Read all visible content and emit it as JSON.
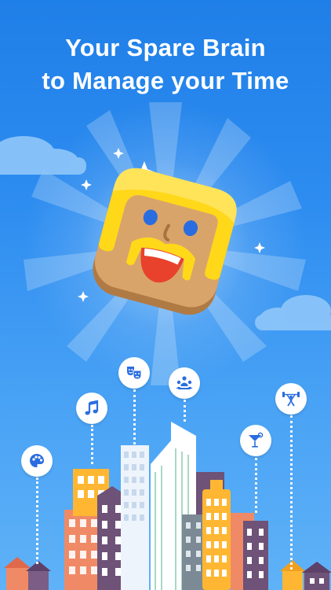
{
  "headline": {
    "line1": "Your Spare Brain",
    "line2": "to Manage your Time"
  },
  "colors": {
    "sky_top": "#1f7fe8",
    "sky_bottom": "#5fb2f7",
    "hair": "#ffd81a",
    "face": "#d9a46a",
    "eyes": "#2a6de0",
    "mouth": "#e8412c",
    "badge_icon": "#2a6de0"
  },
  "features": [
    {
      "icon": "palette-icon"
    },
    {
      "icon": "music-note-icon"
    },
    {
      "icon": "theater-masks-icon"
    },
    {
      "icon": "people-group-icon"
    },
    {
      "icon": "cocktail-icon"
    },
    {
      "icon": "weightlifting-icon"
    }
  ]
}
